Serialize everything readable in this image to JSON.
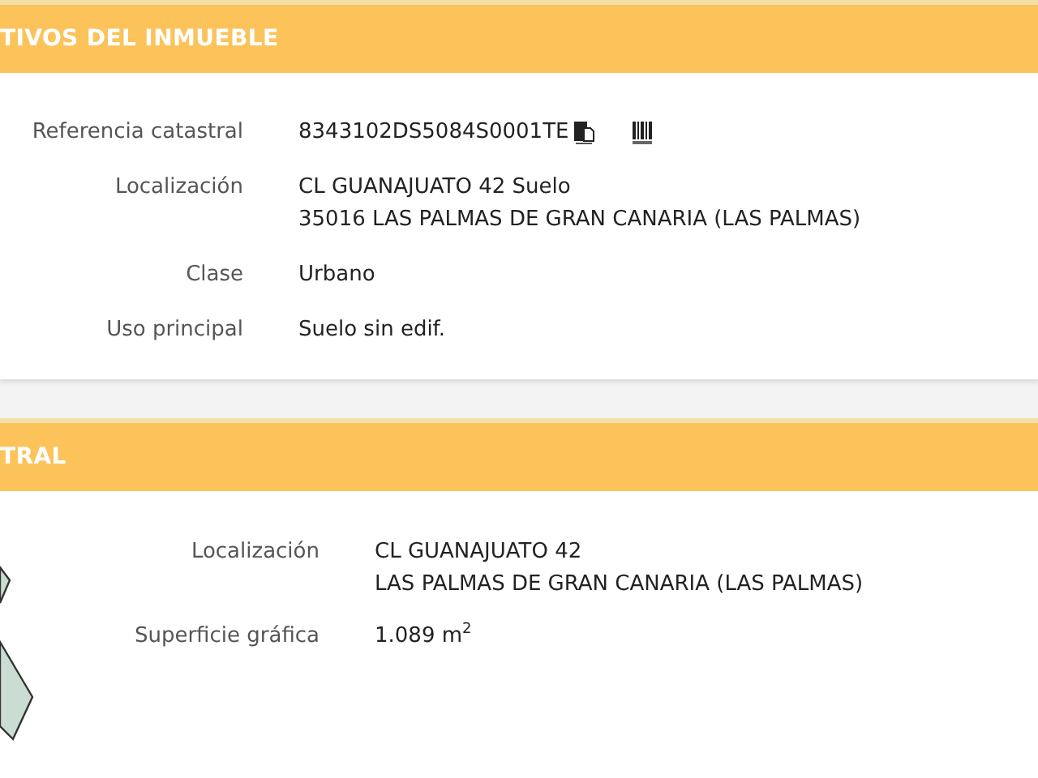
{
  "sections": [
    {
      "title": "TIVOS DEL INMUEBLE",
      "kind": "details",
      "rows": [
        {
          "label": "Referencia catastral",
          "lines": [
            "8343102DS5084S0001TE"
          ],
          "kind": "reference"
        },
        {
          "label": "Localización",
          "lines": [
            "CL GUANAJUATO 42 Suelo",
            "35016 LAS PALMAS DE GRAN CANARIA (LAS PALMAS)"
          ],
          "kind": "text"
        },
        {
          "label": "Clase",
          "lines": [
            "Urbano"
          ],
          "kind": "text"
        },
        {
          "label": "Uso principal",
          "lines": [
            "Suelo sin edif."
          ],
          "kind": "text"
        }
      ]
    },
    {
      "title": "TRAL",
      "kind": "parcel",
      "rows": [
        {
          "label": "Localización",
          "lines": [
            "CL GUANAJUATO 42",
            "LAS PALMAS DE GRAN CANARIA (LAS PALMAS)"
          ],
          "kind": "text"
        },
        {
          "label": "Superficie gráfica",
          "lines": [
            "1.089 m$^{2}$"
          ],
          "kind": "text"
        }
      ]
    }
  ]
}
